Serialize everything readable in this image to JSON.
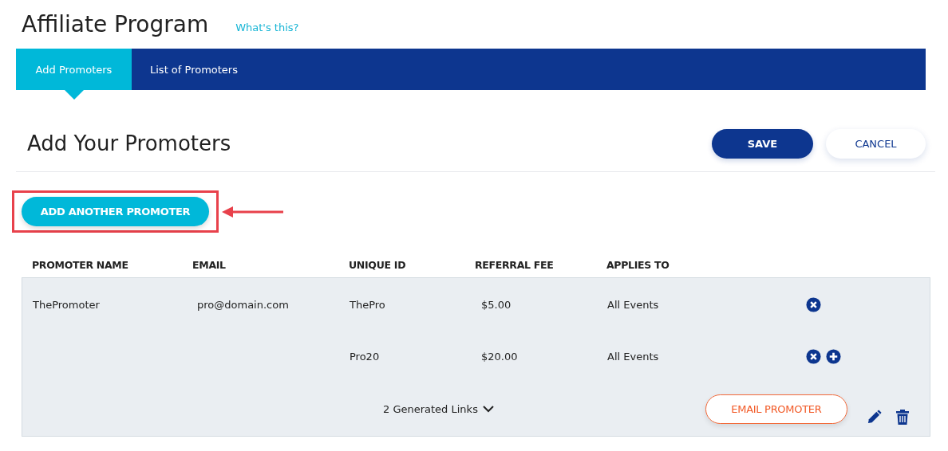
{
  "page_title": "Affiliate Program",
  "help_link": "What's this?",
  "tabs": [
    {
      "label": "Add Promoters",
      "selected": true
    },
    {
      "label": "List of Promoters",
      "selected": false
    }
  ],
  "section_title": "Add Your Promoters",
  "actions": {
    "save": "SAVE",
    "cancel": "CANCEL",
    "add_promoter": "ADD ANOTHER PROMOTER"
  },
  "table": {
    "columns": [
      "PROMOTER NAME",
      "EMAIL",
      "UNIQUE ID",
      "REFERRAL FEE",
      "APPLIES TO"
    ],
    "promoters": [
      {
        "name": "ThePromoter",
        "email": "pro@domain.com",
        "links": [
          {
            "unique_id": "ThePro",
            "referral_fee": "$5.00",
            "applies_to": "All Events",
            "can_add": false
          },
          {
            "unique_id": "Pro20",
            "referral_fee": "$20.00",
            "applies_to": "All Events",
            "can_add": true
          }
        ],
        "links_toggle": "2 Generated Links",
        "email_button": "EMAIL PROMOTER"
      }
    ]
  }
}
